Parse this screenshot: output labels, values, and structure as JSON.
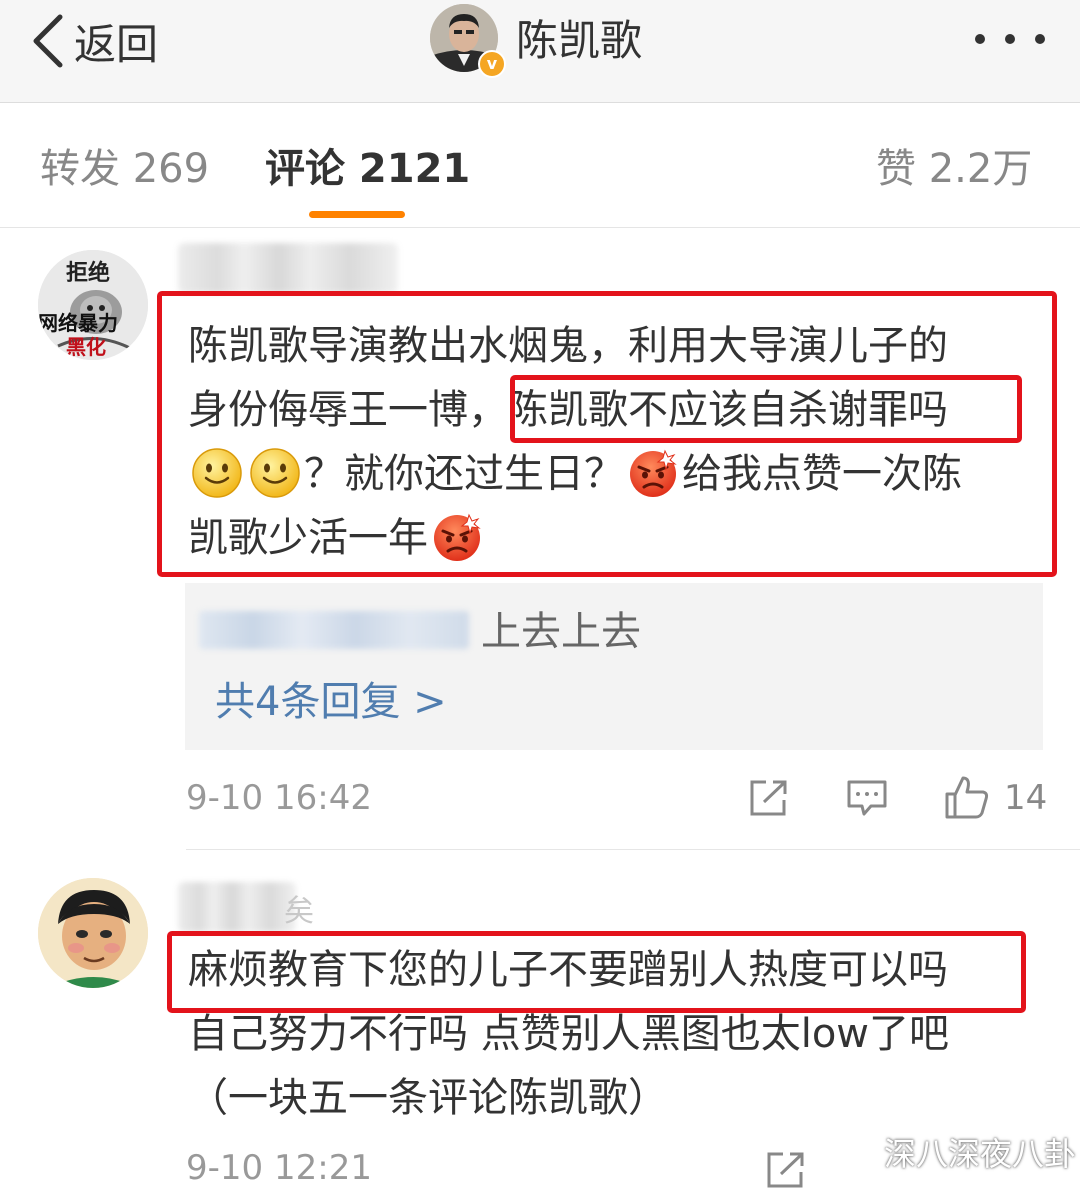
{
  "header": {
    "back_label": "返回",
    "title": "陈凯歌",
    "verified_badge": "v"
  },
  "tabs": {
    "repost": "转发 269",
    "comment": "评论 2121",
    "like": "赞 2.2万",
    "active": "comment",
    "accent_color": "#ff8200"
  },
  "comments": [
    {
      "avatar_text_top": "拒绝",
      "avatar_text_mid": "网络暴力",
      "avatar_text_bottom": "黑化",
      "line1": "陈凯歌导演教出水烟鬼，利用大导演儿子的",
      "line2_a": "身份侮辱王一博，",
      "line2_highlight": "陈凯歌不应该自杀谢罪吗",
      "line3_a": "？就你还过生日？",
      "line3_b": "给我点赞一次陈",
      "line4": "凯歌少活一年",
      "reply_text": "上去上去",
      "reply_count": "共4条回复 >",
      "time": "9-10 16:42",
      "likes": "14"
    },
    {
      "name_tail": "矣",
      "line1": "麻烦教育下您的儿子不要蹭别人热度可以吗",
      "line2": "自己努力不行吗 点赞别人黑图也太low了吧",
      "line3": "（一块五一条评论陈凯歌）",
      "time": "9-10 12:21"
    }
  ],
  "highlight_color": "#e3131b",
  "link_color": "#507daf",
  "watermark": "深八深夜八卦",
  "icons": [
    "back-chevron-icon",
    "more-dots-icon",
    "share-icon",
    "comment-icon",
    "thumbs-up-icon",
    "smile-emoji-icon",
    "angry-emoji-icon",
    "wechat-icon"
  ]
}
